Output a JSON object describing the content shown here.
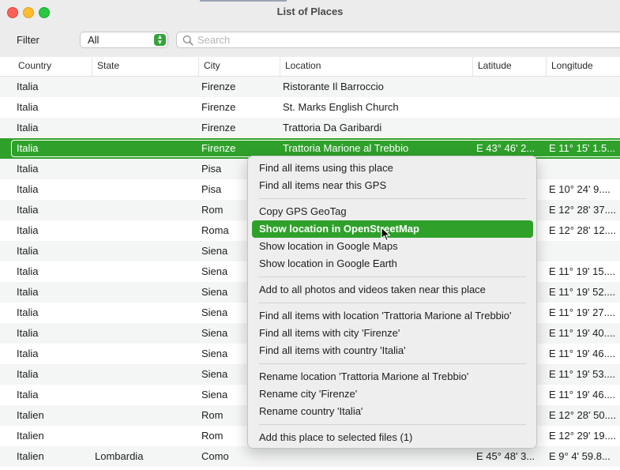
{
  "window": {
    "title": "List of Places"
  },
  "toolbar": {
    "filter_label": "Filter",
    "filter_value": "All",
    "search_placeholder": "Search"
  },
  "columns": [
    "Country",
    "State",
    "City",
    "Location",
    "Latitude",
    "Longitude"
  ],
  "rows": [
    {
      "country": "Italia",
      "state": "",
      "city": "Firenze",
      "location": "Ristorante Il Barroccio",
      "lat": "",
      "lon": ""
    },
    {
      "country": "Italia",
      "state": "",
      "city": "Firenze",
      "location": "St. Marks English Church",
      "lat": "",
      "lon": ""
    },
    {
      "country": "Italia",
      "state": "",
      "city": "Firenze",
      "location": "Trattoria Da Garibardi",
      "lat": "",
      "lon": ""
    },
    {
      "country": "Italia",
      "state": "",
      "city": "Firenze",
      "location": "Trattoria Marione al Trebbio",
      "lat": "E 43° 46' 2...",
      "lon": "E 11° 15' 1.5..."
    },
    {
      "country": "Italia",
      "state": "",
      "city": "Pisa",
      "location": "",
      "lat": "",
      "lon": ""
    },
    {
      "country": "Italia",
      "state": "",
      "city": "Pisa",
      "location": "",
      "lat": "",
      "lon": "E 10° 24' 9...."
    },
    {
      "country": "Italia",
      "state": "",
      "city": "Rom",
      "location": "",
      "lat": "",
      "lon": "E 12° 28' 37...."
    },
    {
      "country": "Italia",
      "state": "",
      "city": "Roma",
      "location": "",
      "lat": "",
      "lon": "E 12° 28' 12...."
    },
    {
      "country": "Italia",
      "state": "",
      "city": "Siena",
      "location": "",
      "lat": "",
      "lon": ""
    },
    {
      "country": "Italia",
      "state": "",
      "city": "Siena",
      "location": "",
      "lat": "",
      "lon": "E 11° 19' 15...."
    },
    {
      "country": "Italia",
      "state": "",
      "city": "Siena",
      "location": "",
      "lat": "",
      "lon": "E 11° 19' 52...."
    },
    {
      "country": "Italia",
      "state": "",
      "city": "Siena",
      "location": "",
      "lat": "",
      "lon": "E 11° 19' 27...."
    },
    {
      "country": "Italia",
      "state": "",
      "city": "Siena",
      "location": "",
      "lat": "",
      "lon": "E 11° 19' 40...."
    },
    {
      "country": "Italia",
      "state": "",
      "city": "Siena",
      "location": "",
      "lat": "",
      "lon": "E 11° 19' 46...."
    },
    {
      "country": "Italia",
      "state": "",
      "city": "Siena",
      "location": "",
      "lat": "",
      "lon": "E 11° 19' 53...."
    },
    {
      "country": "Italia",
      "state": "",
      "city": "Siena",
      "location": "",
      "lat": "",
      "lon": "E 11° 19' 46...."
    },
    {
      "country": "Italien",
      "state": "",
      "city": "Rom",
      "location": "",
      "lat": "",
      "lon": "E 12° 28' 50...."
    },
    {
      "country": "Italien",
      "state": "",
      "city": "Rom",
      "location": "",
      "lat": "",
      "lon": "E 12° 29' 19...."
    },
    {
      "country": "Italien",
      "state": "Lombardia",
      "city": "Como",
      "location": "",
      "lat": "E 45° 48' 3...",
      "lon": "E 9° 4' 59.8..."
    }
  ],
  "selected_row": 3,
  "context_menu": {
    "items": [
      "Find all items using this place",
      "Find all items near this GPS",
      "Copy GPS GeoTag",
      "Show location in  OpenStreetMap",
      "Show location in  Google Maps",
      "Show location in  Google Earth",
      "Add to all photos and videos taken near this place",
      "Find all items with location 'Trattoria Marione al Trebbio'",
      "Find all items with city 'Firenze'",
      "Find all items with country 'Italia'",
      "Rename location 'Trattoria Marione al Trebbio'",
      "Rename city 'Firenze'",
      "Rename country 'Italia'",
      "Add this place to selected files (1)"
    ],
    "highlighted": 3
  },
  "colors": {
    "accent": "#2fa12b",
    "stripe": "#f4f5f5",
    "menu_bg": "#eeeeee"
  }
}
